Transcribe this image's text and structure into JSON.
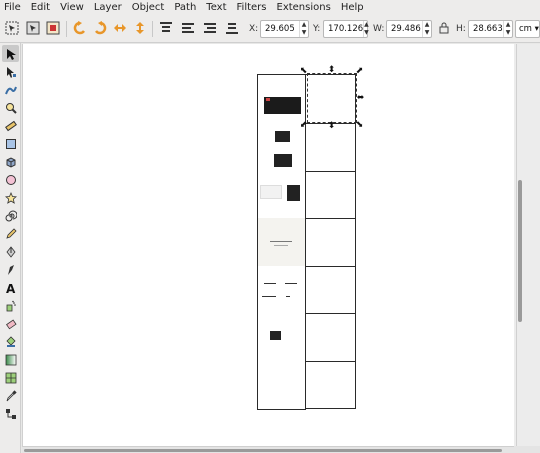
{
  "menubar": {
    "items": [
      "File",
      "Edit",
      "View",
      "Layer",
      "Object",
      "Path",
      "Text",
      "Filters",
      "Extensions",
      "Help"
    ]
  },
  "controls": {
    "x_label": "X:",
    "x_value": "29.605",
    "y_label": "Y:",
    "y_value": "170.126",
    "w_label": "W:",
    "w_value": "29.486",
    "lock_icon": "lock-icon",
    "h_label": "H:",
    "h_value": "28.663",
    "unit": "cm"
  },
  "tools": [
    "selector-tool",
    "node-tool",
    "tweak-tool",
    "zoom-tool",
    "measure-tool",
    "rectangle-tool",
    "3d-box-tool",
    "ellipse-tool",
    "star-tool",
    "spiral-tool",
    "pencil-tool",
    "pen-tool",
    "calligraphy-tool",
    "text-tool",
    "spray-tool",
    "eraser-tool",
    "paint-bucket-tool",
    "gradient-tool",
    "mesh-tool",
    "dropper-tool",
    "connector-tool"
  ],
  "colors": {
    "accent_orange": "#e8962a",
    "selection_blue": "#3a6ea5"
  }
}
